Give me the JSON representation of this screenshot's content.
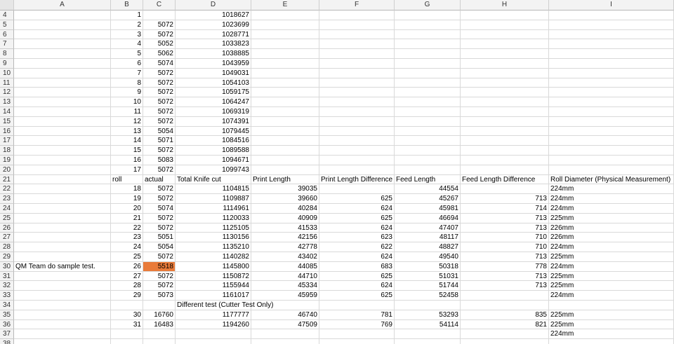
{
  "sheet": {
    "highlight_color": "#e97b3a",
    "columns": [
      "A",
      "B",
      "C",
      "D",
      "E",
      "F",
      "G",
      "H",
      "I"
    ],
    "rows": [
      {
        "n": "4",
        "c": [
          "",
          "1",
          "",
          "1018627",
          "",
          "",
          "",
          "",
          ""
        ]
      },
      {
        "n": "5",
        "c": [
          "",
          "2",
          "5072",
          "1023699",
          "",
          "",
          "",
          "",
          ""
        ]
      },
      {
        "n": "6",
        "c": [
          "",
          "3",
          "5072",
          "1028771",
          "",
          "",
          "",
          "",
          ""
        ]
      },
      {
        "n": "7",
        "c": [
          "",
          "4",
          "5052",
          "1033823",
          "",
          "",
          "",
          "",
          ""
        ]
      },
      {
        "n": "8",
        "c": [
          "",
          "5",
          "5062",
          "1038885",
          "",
          "",
          "",
          "",
          ""
        ]
      },
      {
        "n": "9",
        "c": [
          "",
          "6",
          "5074",
          "1043959",
          "",
          "",
          "",
          "",
          ""
        ]
      },
      {
        "n": "10",
        "c": [
          "",
          "7",
          "5072",
          "1049031",
          "",
          "",
          "",
          "",
          ""
        ]
      },
      {
        "n": "11",
        "c": [
          "",
          "8",
          "5072",
          "1054103",
          "",
          "",
          "",
          "",
          ""
        ]
      },
      {
        "n": "12",
        "c": [
          "",
          "9",
          "5072",
          "1059175",
          "",
          "",
          "",
          "",
          ""
        ]
      },
      {
        "n": "13",
        "c": [
          "",
          "10",
          "5072",
          "1064247",
          "",
          "",
          "",
          "",
          ""
        ]
      },
      {
        "n": "14",
        "c": [
          "",
          "11",
          "5072",
          "1069319",
          "",
          "",
          "",
          "",
          ""
        ]
      },
      {
        "n": "15",
        "c": [
          "",
          "12",
          "5072",
          "1074391",
          "",
          "",
          "",
          "",
          ""
        ]
      },
      {
        "n": "16",
        "c": [
          "",
          "13",
          "5054",
          "1079445",
          "",
          "",
          "",
          "",
          ""
        ]
      },
      {
        "n": "17",
        "c": [
          "",
          "14",
          "5071",
          "1084516",
          "",
          "",
          "",
          "",
          ""
        ]
      },
      {
        "n": "18",
        "c": [
          "",
          "15",
          "5072",
          "1089588",
          "",
          "",
          "",
          "",
          ""
        ]
      },
      {
        "n": "19",
        "c": [
          "",
          "16",
          "5083",
          "1094671",
          "",
          "",
          "",
          "",
          ""
        ]
      },
      {
        "n": "20",
        "c": [
          "",
          "17",
          "5072",
          "1099743",
          "",
          "",
          "",
          "",
          ""
        ]
      },
      {
        "n": "21",
        "c": [
          "",
          "roll",
          "actual",
          "Total Knife cut",
          "Print Length",
          "Print Length Difference",
          "Feed Length",
          "Feed Length Difference",
          "Roll Diameter (Physical Measurement)"
        ],
        "header": true
      },
      {
        "n": "22",
        "c": [
          "",
          "18",
          "5072",
          "1104815",
          "39035",
          "",
          "44554",
          "",
          "224mm"
        ]
      },
      {
        "n": "23",
        "c": [
          "",
          "19",
          "5072",
          "1109887",
          "39660",
          "625",
          "45267",
          "713",
          "224mm"
        ]
      },
      {
        "n": "24",
        "c": [
          "",
          "20",
          "5074",
          "1114961",
          "40284",
          "624",
          "45981",
          "714",
          "224mm"
        ]
      },
      {
        "n": "25",
        "c": [
          "",
          "21",
          "5072",
          "1120033",
          "40909",
          "625",
          "46694",
          "713",
          "225mm"
        ]
      },
      {
        "n": "26",
        "c": [
          "",
          "22",
          "5072",
          "1125105",
          "41533",
          "624",
          "47407",
          "713",
          "226mm"
        ]
      },
      {
        "n": "27",
        "c": [
          "",
          "23",
          "5051",
          "1130156",
          "42156",
          "623",
          "48117",
          "710",
          "226mm"
        ]
      },
      {
        "n": "28",
        "c": [
          "",
          "24",
          "5054",
          "1135210",
          "42778",
          "622",
          "48827",
          "710",
          "224mm"
        ]
      },
      {
        "n": "29",
        "c": [
          "",
          "25",
          "5072",
          "1140282",
          "43402",
          "624",
          "49540",
          "713",
          "225mm"
        ]
      },
      {
        "n": "30",
        "c": [
          "QM Team do sample test.",
          "26",
          "5518",
          "1145800",
          "44085",
          "683",
          "50318",
          "778",
          "224mm"
        ],
        "highlight": 2
      },
      {
        "n": "31",
        "c": [
          "",
          "27",
          "5072",
          "1150872",
          "44710",
          "625",
          "51031",
          "713",
          "225mm"
        ]
      },
      {
        "n": "32",
        "c": [
          "",
          "28",
          "5072",
          "1155944",
          "45334",
          "624",
          "51744",
          "713",
          "225mm"
        ]
      },
      {
        "n": "33",
        "c": [
          "",
          "29",
          "5073",
          "1161017",
          "45959",
          "625",
          "52458",
          "",
          "224mm"
        ]
      },
      {
        "n": "34",
        "c": [
          "",
          "",
          "",
          "Different test (Cutter Test Only)",
          "",
          "",
          "",
          "",
          ""
        ],
        "header": true
      },
      {
        "n": "35",
        "c": [
          "",
          "30",
          "16760",
          "1177777",
          "46740",
          "781",
          "53293",
          "835",
          "225mm"
        ]
      },
      {
        "n": "36",
        "c": [
          "",
          "31",
          "16483",
          "1194260",
          "47509",
          "769",
          "54114",
          "821",
          "225mm"
        ]
      },
      {
        "n": "37",
        "c": [
          "",
          "",
          "",
          "",
          "",
          "",
          "",
          "",
          "224mm"
        ]
      },
      {
        "n": "38",
        "c": [
          "",
          "",
          "",
          "",
          "",
          "",
          "",
          "",
          ""
        ]
      }
    ]
  }
}
